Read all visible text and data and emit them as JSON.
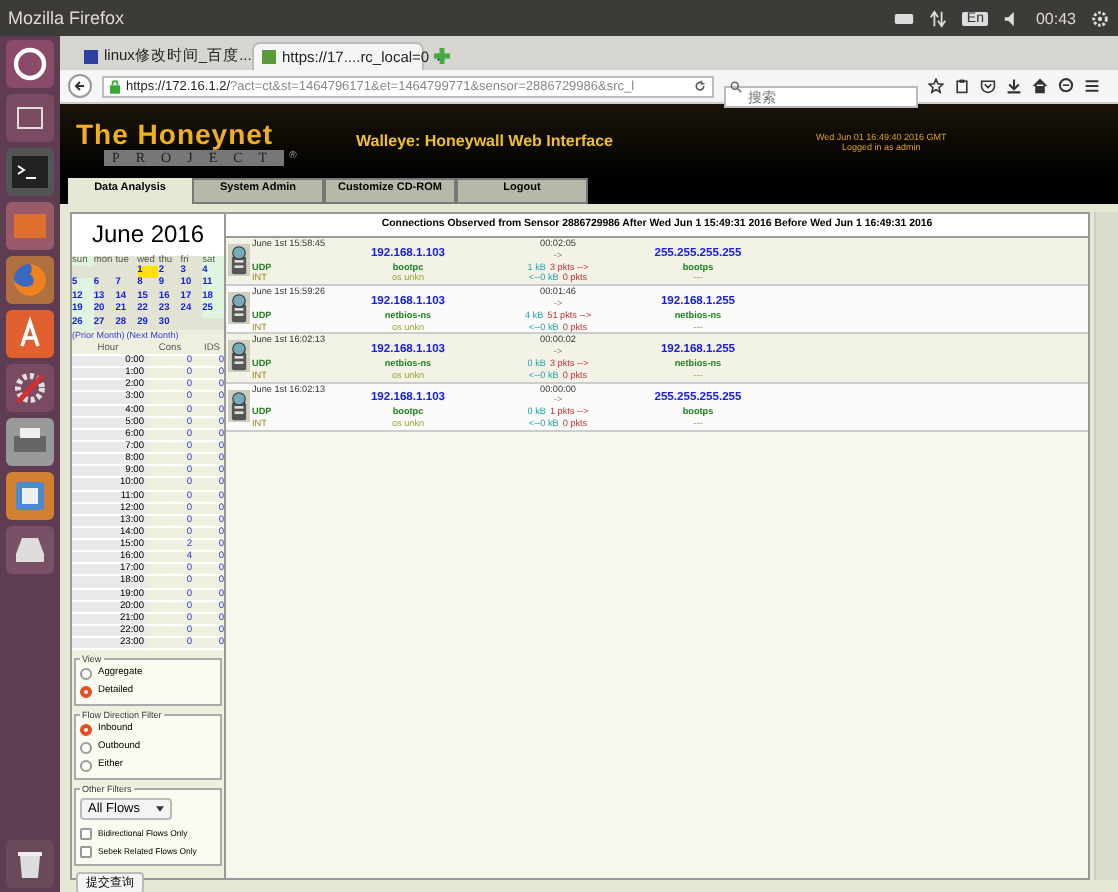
{
  "system_bar": {
    "title": "Mozilla Firefox",
    "keyboard": "En",
    "time": "00:43"
  },
  "browser": {
    "tabs": [
      {
        "label": "linux修改时间_百度...",
        "selected": false
      },
      {
        "label": "https://17....rc_local=0",
        "selected": true
      }
    ],
    "url": {
      "host": "https://172.16.1.2/",
      "rest": "?act=ct&st=1464796171&et=1464799771&sensor=2886729986&src_l"
    },
    "search": {
      "placeholder": "搜索"
    }
  },
  "header": {
    "logo_top": "The Honeynet",
    "logo_bottom": "PROJECT",
    "logo_mark": "®",
    "title": "Walleye: Honeywall Web Interface",
    "date": "Wed Jun 01 16:49:40 2016 GMT",
    "login": "Logged in as admin"
  },
  "nav_tabs": [
    {
      "label": "Data Analysis",
      "selected": true
    },
    {
      "label": "System Admin",
      "selected": false
    },
    {
      "label": "Customize CD-ROM",
      "selected": false
    },
    {
      "label": "Logout",
      "selected": false
    }
  ],
  "calendar": {
    "title": "June 2016",
    "weekdays": [
      "sun",
      "mon",
      "tue",
      "wed",
      "thu",
      "fri",
      "sat"
    ],
    "weeks": [
      [
        {
          "selected": false
        },
        {
          "selected": false
        },
        {
          "selected": false
        },
        {
          "day": "1",
          "selected": true
        },
        {
          "day": "2",
          "selected": false
        },
        {
          "day": "3",
          "selected": false
        },
        {
          "day": "4",
          "selected": false
        }
      ],
      [
        {
          "day": "5",
          "selected": false
        },
        {
          "day": "6",
          "selected": false
        },
        {
          "day": "7",
          "selected": false
        },
        {
          "day": "8",
          "selected": false
        },
        {
          "day": "9",
          "selected": false
        },
        {
          "day": "10",
          "selected": false
        },
        {
          "day": "11",
          "selected": false
        }
      ],
      [
        {
          "day": "12",
          "selected": false
        },
        {
          "day": "13",
          "selected": false
        },
        {
          "day": "14",
          "selected": false
        },
        {
          "day": "15",
          "selected": false
        },
        {
          "day": "16",
          "selected": false
        },
        {
          "day": "17",
          "selected": false
        },
        {
          "day": "18",
          "selected": false
        }
      ],
      [
        {
          "day": "19",
          "selected": false
        },
        {
          "day": "20",
          "selected": false
        },
        {
          "day": "21",
          "selected": false
        },
        {
          "day": "22",
          "selected": false
        },
        {
          "day": "23",
          "selected": false
        },
        {
          "day": "24",
          "selected": false
        },
        {
          "day": "25",
          "selected": false
        }
      ],
      [
        {
          "day": "26",
          "selected": false
        },
        {
          "day": "27",
          "selected": false
        },
        {
          "day": "28",
          "selected": false
        },
        {
          "day": "29",
          "selected": false
        },
        {
          "day": "30",
          "selected": false
        },
        {
          "selected": false
        },
        {
          "selected": false
        }
      ]
    ],
    "prior": "(Prior Month)",
    "next": "(Next Month)"
  },
  "hours": {
    "columns": [
      "Hour",
      "Cons",
      "IDS"
    ],
    "rows": [
      {
        "hour": "0:00",
        "cons": "0",
        "ids": "0"
      },
      {
        "hour": "1:00",
        "cons": "0",
        "ids": "0"
      },
      {
        "hour": "2:00",
        "cons": "0",
        "ids": "0"
      },
      {
        "hour": "3:00",
        "cons": "0",
        "ids": "0"
      },
      {
        "hour": "4:00",
        "cons": "0",
        "ids": "0"
      },
      {
        "hour": "5:00",
        "cons": "0",
        "ids": "0"
      },
      {
        "hour": "6:00",
        "cons": "0",
        "ids": "0"
      },
      {
        "hour": "7:00",
        "cons": "0",
        "ids": "0"
      },
      {
        "hour": "8:00",
        "cons": "0",
        "ids": "0"
      },
      {
        "hour": "9:00",
        "cons": "0",
        "ids": "0"
      },
      {
        "hour": "10:00",
        "cons": "0",
        "ids": "0"
      },
      {
        "hour": "11:00",
        "cons": "0",
        "ids": "0"
      },
      {
        "hour": "12:00",
        "cons": "0",
        "ids": "0"
      },
      {
        "hour": "13:00",
        "cons": "0",
        "ids": "0"
      },
      {
        "hour": "14:00",
        "cons": "0",
        "ids": "0"
      },
      {
        "hour": "15:00",
        "cons": "2",
        "ids": "0"
      },
      {
        "hour": "16:00",
        "cons": "4",
        "ids": "0"
      },
      {
        "hour": "17:00",
        "cons": "0",
        "ids": "0"
      },
      {
        "hour": "18:00",
        "cons": "0",
        "ids": "0"
      },
      {
        "hour": "19:00",
        "cons": "0",
        "ids": "0"
      },
      {
        "hour": "20:00",
        "cons": "0",
        "ids": "0"
      },
      {
        "hour": "21:00",
        "cons": "0",
        "ids": "0"
      },
      {
        "hour": "22:00",
        "cons": "0",
        "ids": "0"
      },
      {
        "hour": "23:00",
        "cons": "0",
        "ids": "0"
      }
    ]
  },
  "view": {
    "legend": "View",
    "options": [
      {
        "label": "Aggregate",
        "selected": false
      },
      {
        "label": "Detailed",
        "selected": true
      }
    ]
  },
  "flow_direction": {
    "legend": "Flow Direction Filter",
    "options": [
      {
        "label": "Inbound",
        "selected": true
      },
      {
        "label": "Outbound",
        "selected": false
      },
      {
        "label": "Either",
        "selected": false
      }
    ]
  },
  "other_filters": {
    "legend": "Other Filters",
    "dropdown": "All Flows",
    "checkboxes": [
      {
        "label": "Bidirectional Flows Only",
        "checked": false
      },
      {
        "label": "Sebek Related Flows Only",
        "checked": false
      }
    ]
  },
  "submit": "提交查询",
  "connections": {
    "heading": "Connections Observed from Sensor 2886729986 After Wed Jun 1 15:49:31 2016 Before Wed Jun 1 16:49:31 2016",
    "rows": [
      {
        "time": "June 1st 15:58:45",
        "duration": "00:02:05",
        "src_ip": "192.168.1.103",
        "arrow": "->",
        "dst_ip": "255.255.255.255",
        "proto": "UDP",
        "src_port": "bootpc",
        "out_bytes": "1 kB",
        "out_pkts": "3 pkts -->",
        "dst_port": "bootps",
        "dir": "INT",
        "os": "os unkn",
        "in_bytes": "<--0 kB",
        "in_pkts": "0 pkts",
        "dst_os": "---"
      },
      {
        "time": "June 1st 15:59:26",
        "duration": "00:01:46",
        "src_ip": "192.168.1.103",
        "arrow": "->",
        "dst_ip": "192.168.1.255",
        "proto": "UDP",
        "src_port": "netbios-ns",
        "out_bytes": "4 kB",
        "out_pkts": "51 pkts -->",
        "dst_port": "netbios-ns",
        "dir": "INT",
        "os": "os unkn",
        "in_bytes": "<--0 kB",
        "in_pkts": "0 pkts",
        "dst_os": "---"
      },
      {
        "time": "June 1st 16:02:13",
        "duration": "00:00:02",
        "src_ip": "192.168.1.103",
        "arrow": "->",
        "dst_ip": "192.168.1.255",
        "proto": "UDP",
        "src_port": "netbios-ns",
        "out_bytes": "0 kB",
        "out_pkts": "3 pkts -->",
        "dst_port": "netbios-ns",
        "dir": "INT",
        "os": "os unkn",
        "in_bytes": "<--0 kB",
        "in_pkts": "0 pkts",
        "dst_os": "---"
      },
      {
        "time": "June 1st 16:02:13",
        "duration": "00:00:00",
        "src_ip": "192.168.1.103",
        "arrow": "->",
        "dst_ip": "255.255.255.255",
        "proto": "UDP",
        "src_port": "bootpc",
        "out_bytes": "0 kB",
        "out_pkts": "1 pkts -->",
        "dst_port": "bootps",
        "dir": "INT",
        "os": "os unkn",
        "in_bytes": "<--0 kB",
        "in_pkts": "0 pkts",
        "dst_os": "---"
      }
    ]
  }
}
